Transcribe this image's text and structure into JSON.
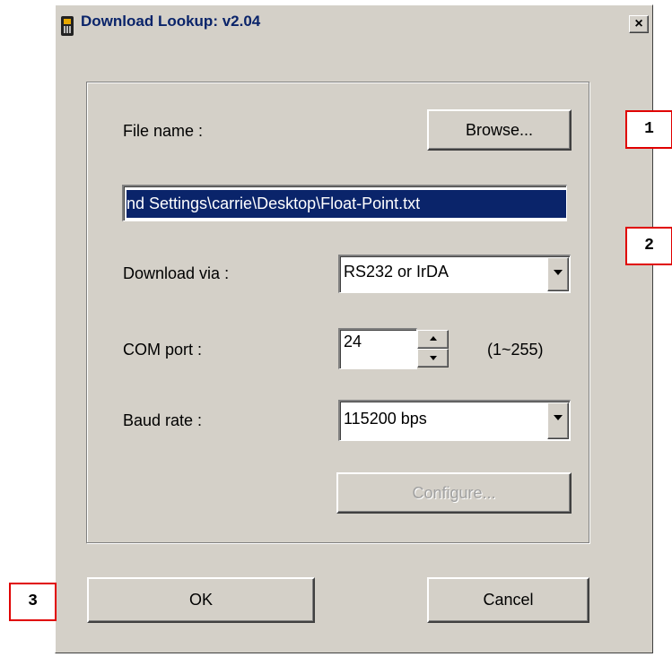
{
  "dialog": {
    "title": "Download Lookup: v2.04",
    "close_glyph": "×",
    "icon": "handheld-terminal-icon"
  },
  "file": {
    "label": "File name :",
    "browse_label": "Browse...",
    "path_visible": "nd Settings\\carrie\\Desktop\\Float-Point.txt"
  },
  "download": {
    "label": "Download via :",
    "value": "RS232 or IrDA"
  },
  "com": {
    "label": "COM port :",
    "value": "24",
    "range": "(1~255)"
  },
  "baud": {
    "label": "Baud rate :",
    "value": "115200 bps"
  },
  "configure_label": "Configure...",
  "ok_label": "OK",
  "cancel_label": "Cancel",
  "callouts": [
    "1",
    "2",
    "3"
  ],
  "colors": {
    "dialog_bg": "#d4d0c8",
    "title_text": "#0a246a",
    "selection": "#0a246a",
    "callout_border": "#e00000"
  }
}
